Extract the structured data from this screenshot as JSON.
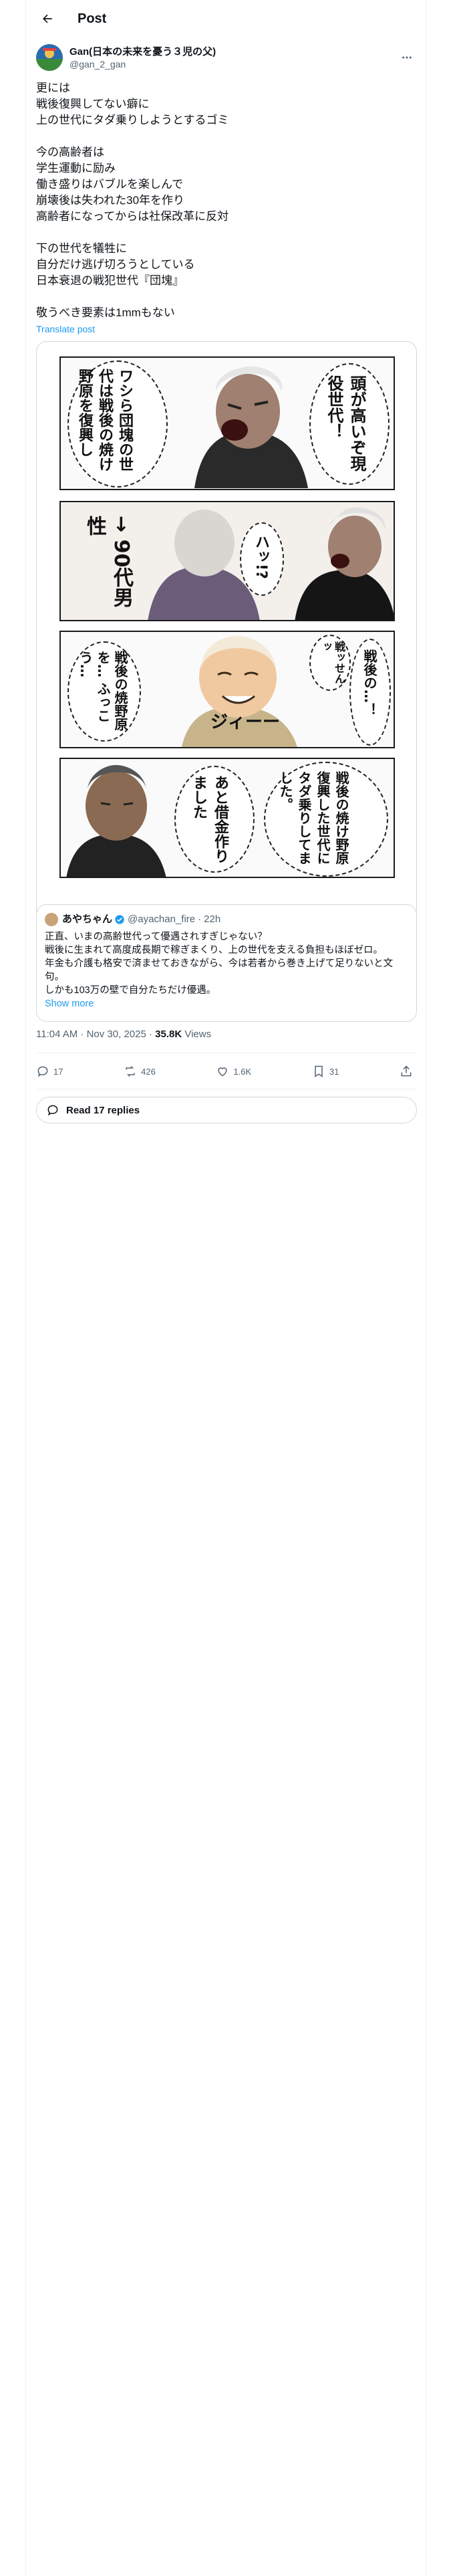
{
  "header": {
    "title": "Post"
  },
  "author": {
    "name": "Gan(日本の未来を憂う３児の父)",
    "handle": "@gan_2_gan"
  },
  "post": {
    "lines": [
      "更には",
      "戦後復興してない癖に",
      "上の世代にタダ乗りしようとするゴミ",
      "",
      "今の高齢者は",
      "学生運動に励み",
      "働き盛りはバブルを楽しんで",
      "崩壊後は失われた30年を作り",
      "高齢者になってからは社保改革に反対",
      "",
      "下の世代を犠牲に",
      "自分だけ逃げ切ろうとしている",
      "日本衰退の戦犯世代『団塊』",
      "",
      "敬うべき要素は1mmもない"
    ],
    "translate": "Translate post"
  },
  "comic": {
    "p1_bubble": "頭が高いぞ現役世代！",
    "p1_right": "ワシら団塊の世代は戦後の焼け野原を復興し",
    "p2_caption": "→ 90代男性",
    "p2_shout": "ハッ!?",
    "p3_speech1": "戦ッせんッ",
    "p3_speech2": "戦後の…！",
    "p3_speech3": "戦後の焼野原を… ふっこう…",
    "p3_sfx": "ジィーー",
    "p4_speech1": "戦後の焼け野原復興した世代にタダ乗りしてました。",
    "p4_speech2": "あと借金作りました"
  },
  "quote": {
    "name": "あやちゃん",
    "handle": "@ayachan_fire",
    "time": "22h",
    "lines": [
      "正直、いまの高齢世代って優遇されすぎじゃない？",
      "戦後に生まれて高度成長期で稼ぎまくり、上の世代を支える負担もほぼゼロ。",
      "年金も介護も格安で済ませておきながら、今は若者から巻き上げて足りないと文句。",
      "しかも103万の壁で自分たちだけ優遇。"
    ],
    "show_more": "Show more"
  },
  "meta": {
    "time": "11:04 AM · Nov 30, 2025 · ",
    "views_count": "35.8K",
    "views_label": " Views"
  },
  "actions": {
    "replies": "17",
    "reposts": "426",
    "likes": "1.6K",
    "bookmarks": "31"
  },
  "read_replies": "Read 17 replies"
}
